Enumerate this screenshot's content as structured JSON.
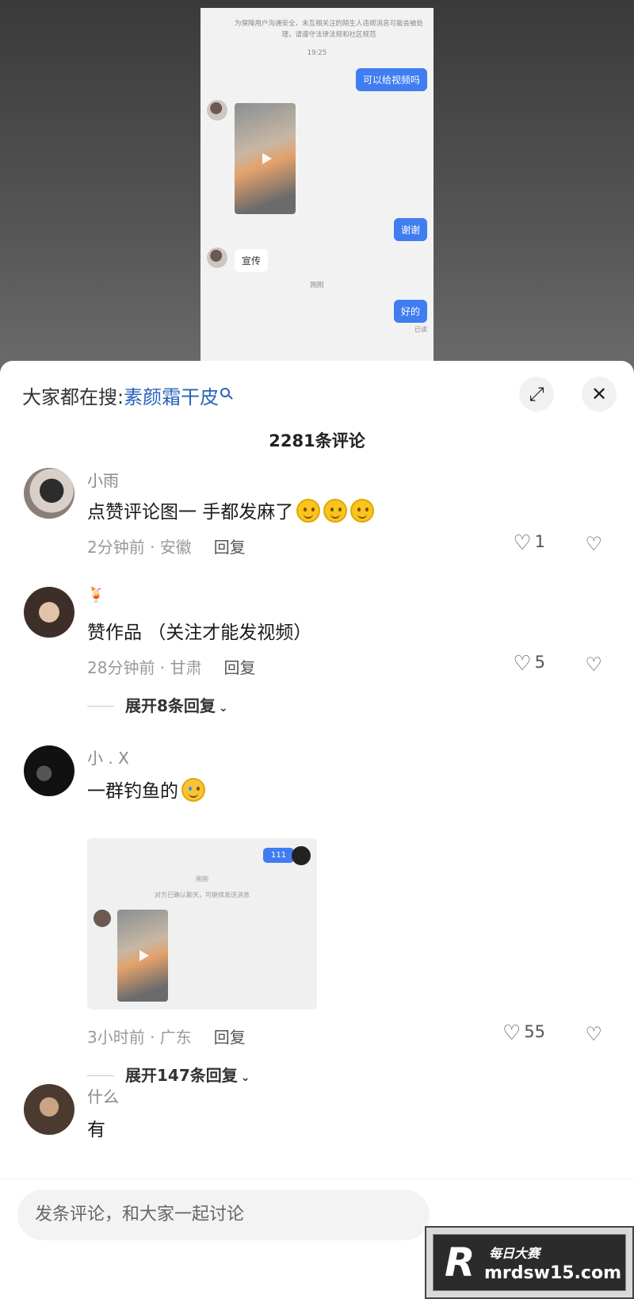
{
  "chat_screenshot": {
    "notice": "为保障用户沟通安全，未互相关注的陌生人违规消息可能会被处理，请遵守法律法规和社区规范",
    "time1": "19:25",
    "msg_me_1": "可以给视频吗",
    "msg_me_2": "谢谢",
    "msg_other_1": "宣传",
    "time2": "刚刚",
    "msg_me_3": "好的",
    "read_status": "已读"
  },
  "header": {
    "search_prefix": "大家都在搜:",
    "search_term": "素颜霜干皮",
    "expand_icon": "⤢",
    "close_icon": "✕"
  },
  "comment_count": "2281条评论",
  "comments": [
    {
      "username": "小雨",
      "text": "点赞评论图一 手都发麻了",
      "time_location": "2分钟前 · 安徽",
      "reply": "回复",
      "likes": "1"
    },
    {
      "username": "",
      "text": "赞作品 （关注才能发视频）",
      "time_location": "28分钟前 · 甘肃",
      "reply": "回复",
      "likes": "5",
      "expand": "展开8条回复"
    },
    {
      "username": "小 . X",
      "text": "一群钓鱼的",
      "time_location": "3小时前 · 广东",
      "reply": "回复",
      "likes": "55",
      "expand": "展开147条回复",
      "attachment": {
        "bubble": "111",
        "time": "刚刚",
        "note": "对方已确认聊天，可继续发送消息"
      }
    },
    {
      "username": "什么",
      "text": "有"
    }
  ],
  "input": {
    "placeholder": "发条评论，和大家一起讨论"
  },
  "watermark": {
    "logo": "R",
    "line1": "每日大赛",
    "line2": "mrdsw15.com"
  }
}
